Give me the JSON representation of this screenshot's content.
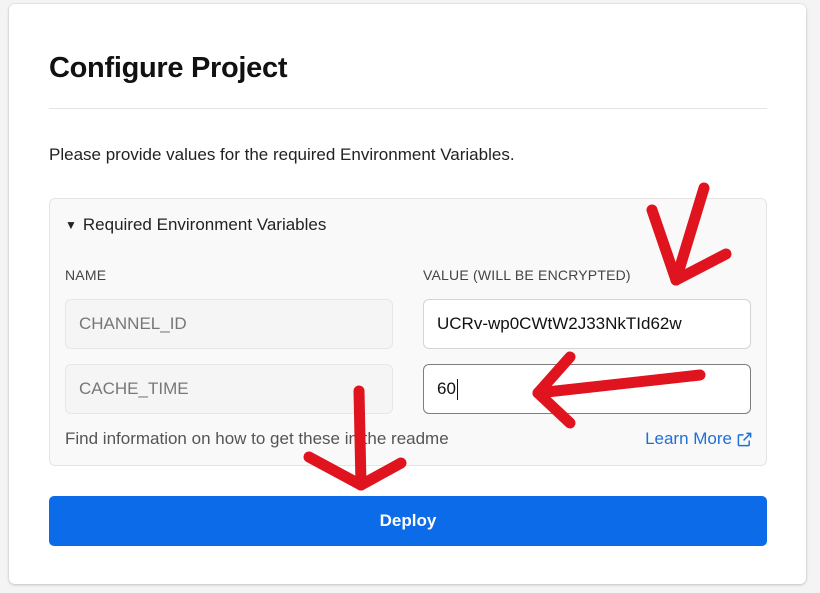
{
  "page": {
    "title": "Configure Project",
    "description": "Please provide values for the required Environment Variables."
  },
  "env_section": {
    "summary": "Required Environment Variables",
    "caret_icon": "triangle-down-icon",
    "name_header": "NAME",
    "value_header": "VALUE (WILL BE ENCRYPTED)",
    "rows": [
      {
        "name": "CHANNEL_ID",
        "value": "UCRv-wp0CWtW2J33NkTId62w"
      },
      {
        "name": "CACHE_TIME",
        "value": "60"
      }
    ],
    "hint": "Find information on how to get these in the readme",
    "learn_more": "Learn More",
    "learn_more_icon": "external-link-icon"
  },
  "deploy_label": "Deploy",
  "colors": {
    "accent": "#0b6be8",
    "link": "#1e6fd9",
    "annotation_arrow": "#e0141e"
  }
}
